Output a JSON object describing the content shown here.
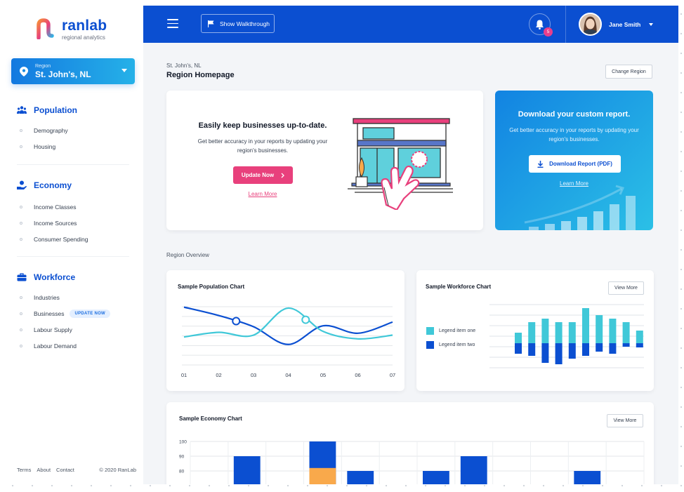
{
  "brand": {
    "name": "ranlab",
    "tagline": "regional analytics"
  },
  "region": {
    "label": "Region",
    "name": "St. John's, NL"
  },
  "nav": {
    "sections": [
      {
        "title": "Population",
        "items": [
          {
            "label": "Demography"
          },
          {
            "label": "Housing"
          }
        ]
      },
      {
        "title": "Economy",
        "items": [
          {
            "label": "Income Classes"
          },
          {
            "label": "Income Sources"
          },
          {
            "label": "Consumer Spending"
          }
        ]
      },
      {
        "title": "Workforce",
        "items": [
          {
            "label": "Industries"
          },
          {
            "label": "Businesses",
            "badge": "UPDATE NOW"
          },
          {
            "label": "Labour Supply"
          },
          {
            "label": "Labour Demand"
          }
        ]
      }
    ]
  },
  "footer": {
    "terms": "Terms",
    "about": "About",
    "contact": "Contact",
    "copyright": "© 2020 RanLab"
  },
  "topbar": {
    "walkthrough_label": "Show Walkthrough",
    "notifications_count": "5",
    "user_name": "Jane Smith"
  },
  "page": {
    "breadcrumb": "St. John's, NL",
    "title": "Region Homepage",
    "change_region_label": "Change Region",
    "section_label": "Region Overview"
  },
  "promo": {
    "title": "Easily keep businesses up-to-date.",
    "text": "Get better accuracy in your reports by updating your region's businesses.",
    "button_label": "Update Now",
    "link_label": "Learn More"
  },
  "report": {
    "title": "Download your custom report.",
    "text": "Get better accuracy in your reports by updating your region's businesses.",
    "button_label": "Download Report (PDF)",
    "link_label": "Learn More"
  },
  "colors": {
    "primary": "#0b4fd1",
    "accent_pink": "#e8407c",
    "teal": "#40c8d8",
    "orange": "#f9a94b"
  },
  "chart_data": [
    {
      "type": "line",
      "title": "Sample Population Chart",
      "view_more": "",
      "x": [
        "01",
        "02",
        "03",
        "04",
        "05",
        "06",
        "07"
      ],
      "series": [
        {
          "color": "#0b4fd1",
          "values": [
            6.2,
            5.3,
            4.1,
            2.2,
            4.2,
            3.4,
            4.6
          ]
        },
        {
          "color": "#40c8d8",
          "values": [
            3.0,
            3.5,
            3.2,
            6.1,
            3.6,
            2.8,
            3.2
          ]
        }
      ],
      "ylim": [
        0,
        7
      ],
      "grid": true
    },
    {
      "type": "bar",
      "title": "Sample Workforce Chart",
      "view_more": "View More",
      "legend": [
        "Legend item one",
        "Legend item two"
      ],
      "series": [
        {
          "name": "Legend item one",
          "color": "#40c8d8",
          "values": [
            1.5,
            3.0,
            3.5,
            3.0,
            3.0,
            5.0,
            4.0,
            3.5,
            3.0,
            1.8
          ]
        },
        {
          "name": "Legend item two",
          "color": "#0b4fd1",
          "values": [
            -1.5,
            -1.8,
            -2.8,
            -3.0,
            -2.2,
            -1.8,
            -1.2,
            -1.5,
            -0.5,
            -0.6
          ]
        }
      ],
      "ylim": [
        -3.5,
        5.5
      ],
      "grid": true,
      "legend_position": "left"
    },
    {
      "type": "bar",
      "title": "Sample Economy Chart",
      "view_more": "View More",
      "y_ticks": [
        "100",
        "90",
        "80"
      ],
      "ylim": [
        60,
        100
      ],
      "columns": 12,
      "bars": [
        {
          "col": 1,
          "value": 90,
          "color": "#0b4fd1"
        },
        {
          "col": 3,
          "value": 100,
          "color": "#0b4fd1",
          "stack_value": 82,
          "stack_color": "#f9a94b"
        },
        {
          "col": 4,
          "value": 80,
          "color": "#0b4fd1"
        },
        {
          "col": 6,
          "value": 80,
          "color": "#0b4fd1"
        },
        {
          "col": 7,
          "value": 90,
          "color": "#0b4fd1"
        },
        {
          "col": 10,
          "value": 80,
          "color": "#0b4fd1"
        }
      ],
      "grid": true
    }
  ]
}
